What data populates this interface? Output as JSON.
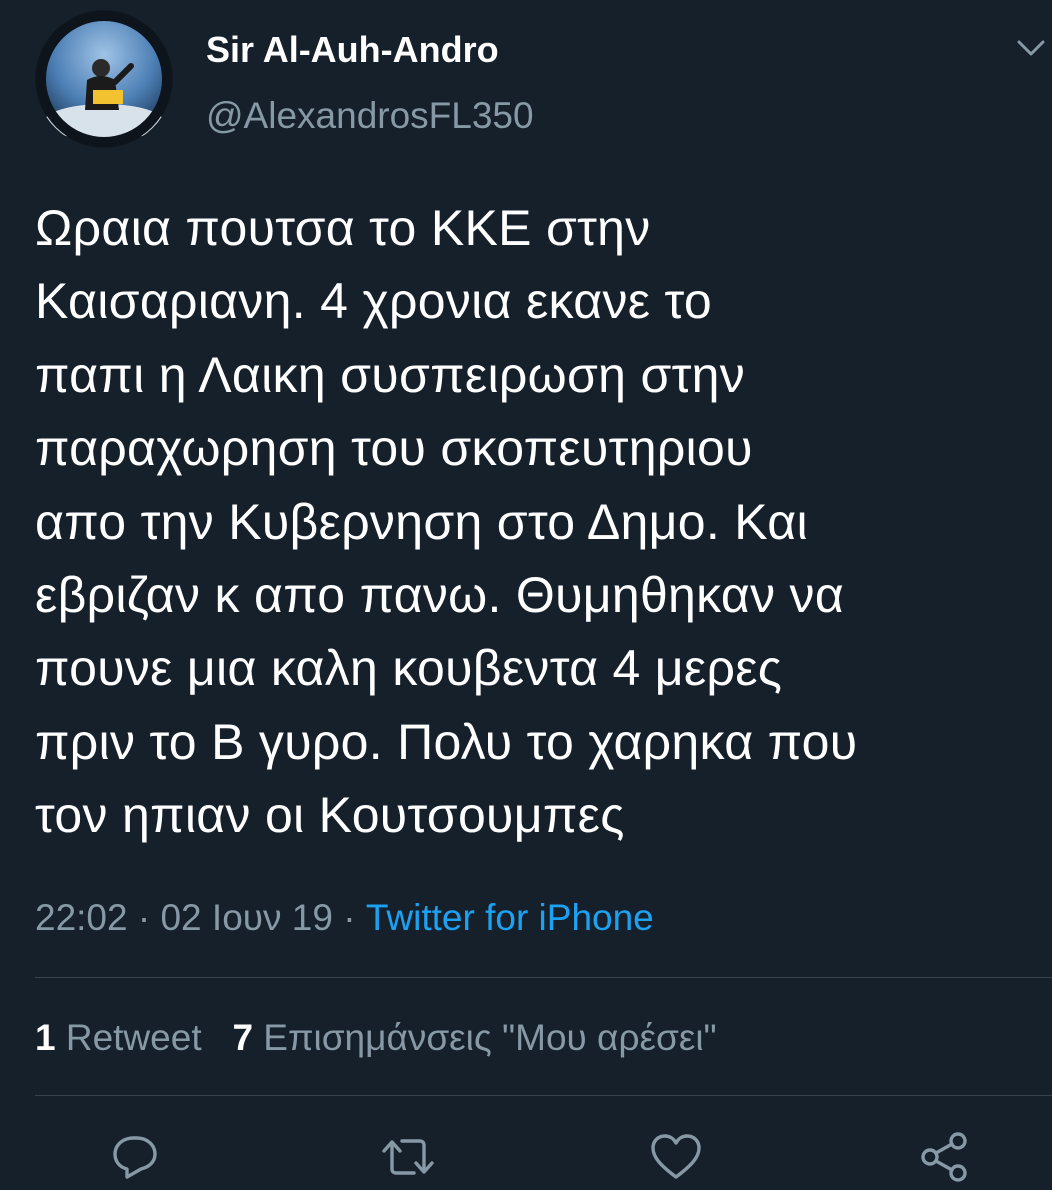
{
  "tweet": {
    "author": {
      "display_name": "Sir Al-Auh-Andro",
      "handle": "@AlexandrosFL350",
      "avatar_icon": "avatar-photo"
    },
    "text_lines": [
      "Ωραια πουτσα το ΚΚΕ στην",
      "Καισαριανη. 4 χρονια εκανε το",
      "παπι η Λαικη συσπειρωση στην",
      "παραχωρηση του σκοπευτηριου",
      "απο την Κυβερνηση στο Δημο. Και",
      "εβριζαν κ απο πανω. Θυμηθηκαν να",
      "πουνε μια καλη κουβεντα 4 μερες",
      "πριν το Β γυρο. Πολυ το χαρηκα που",
      "τον ηπιαν οι Κουτσουμπες"
    ],
    "time": "22:02",
    "separator": "·",
    "date": "02 Ιουν 19",
    "source": "Twitter for iPhone",
    "stats": {
      "retweets_count": "1",
      "retweets_label": "Retweet",
      "likes_count": "7",
      "likes_label": "Επισημάνσεις \"Μου αρέσει\""
    }
  },
  "actions": {
    "reply_icon": "reply-icon",
    "retweet_icon": "retweet-icon",
    "like_icon": "heart-icon",
    "share_icon": "share-icon"
  },
  "colors": {
    "background": "#15202b",
    "secondary_text": "#8899a6",
    "link": "#1da1f2",
    "divider": "#38444d"
  }
}
